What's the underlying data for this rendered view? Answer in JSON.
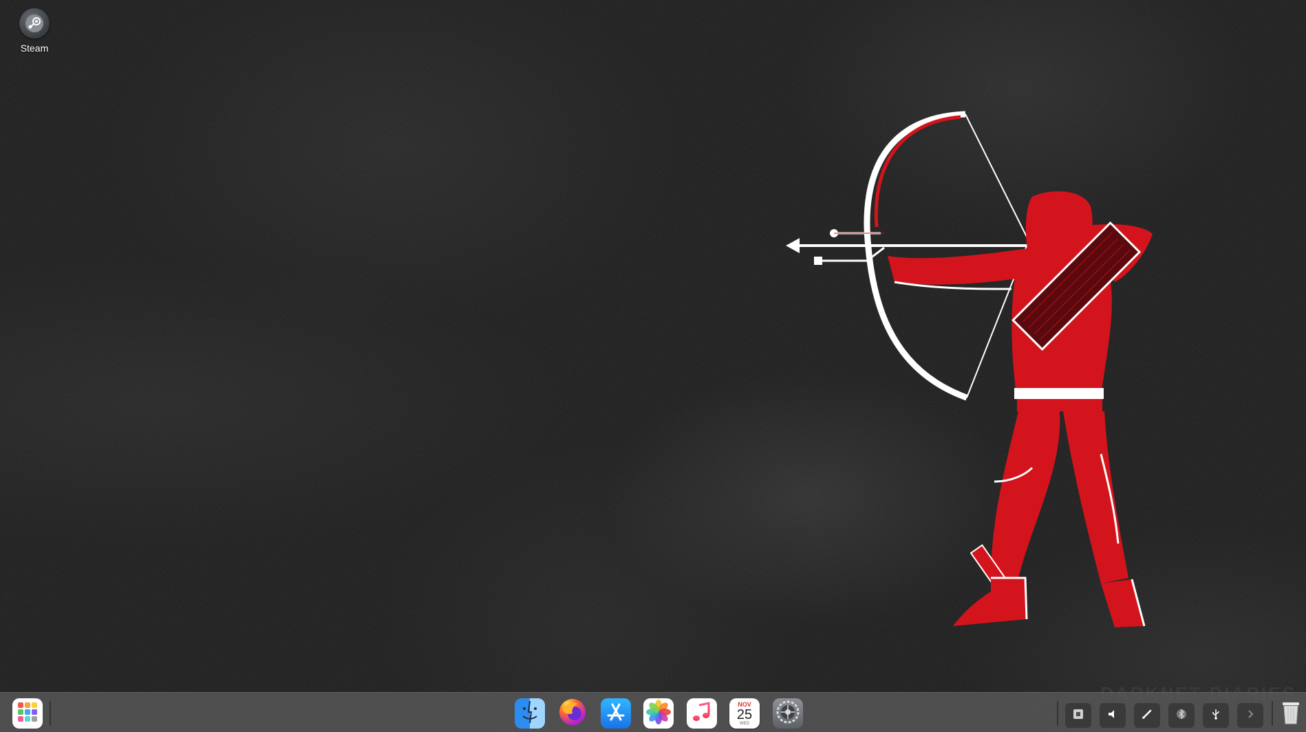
{
  "desktop": {
    "icons": [
      {
        "label": "Steam",
        "icon": "steam-icon"
      }
    ],
    "watermark": "DARKNET DIARIES"
  },
  "dock": {
    "launcher": {
      "icon": "app-grid-icon"
    },
    "apps": [
      {
        "name": "Finder",
        "icon": "finder-icon"
      },
      {
        "name": "Firefox",
        "icon": "firefox-icon"
      },
      {
        "name": "App Store",
        "icon": "app-store-icon"
      },
      {
        "name": "Photos",
        "icon": "photos-icon"
      },
      {
        "name": "Music",
        "icon": "music-icon"
      },
      {
        "name": "Calendar",
        "icon": "calendar-icon",
        "month": "NOV",
        "day": "25",
        "weekday": "WED"
      },
      {
        "name": "System Settings",
        "icon": "settings-icon"
      }
    ],
    "tray": [
      {
        "icon": "window-icon"
      },
      {
        "icon": "volume-icon"
      },
      {
        "icon": "pen-icon"
      },
      {
        "icon": "bluetooth-icon"
      },
      {
        "icon": "usb-icon"
      },
      {
        "icon": "chevron-right-icon"
      }
    ],
    "trash": {
      "icon": "trash-icon"
    }
  },
  "colors": {
    "dock_bg": "#585858",
    "accent_red": "#d4141c",
    "background": "#141414"
  }
}
